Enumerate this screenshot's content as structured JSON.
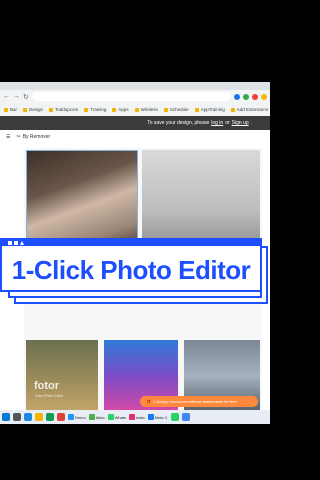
{
  "browser": {
    "bookmarks": [
      "Bar",
      "Design",
      "Toddopcom",
      "Training",
      "Apps",
      "Wireless",
      "Schedule",
      "AppTraining",
      "Add Extensions"
    ]
  },
  "page": {
    "banner": {
      "prefix": "To save your design, please",
      "login": "log in",
      "or": "or",
      "signup": "Sign up",
      "suffix": "."
    },
    "toolbar": {
      "by_label": "By Remover"
    },
    "watermark": {
      "brand": "fotor",
      "sub": "Fotor Photo Editor"
    },
    "toast": "1 Design resources without watermarks for free"
  },
  "headline": "1-Click Photo Editor",
  "taskbar": {
    "apps": [
      "Demo",
      "Akka",
      "Whats",
      "Insta",
      "Meta C"
    ]
  },
  "colors": {
    "accent": "#1d4fff",
    "toast": "#ff8a3d"
  }
}
